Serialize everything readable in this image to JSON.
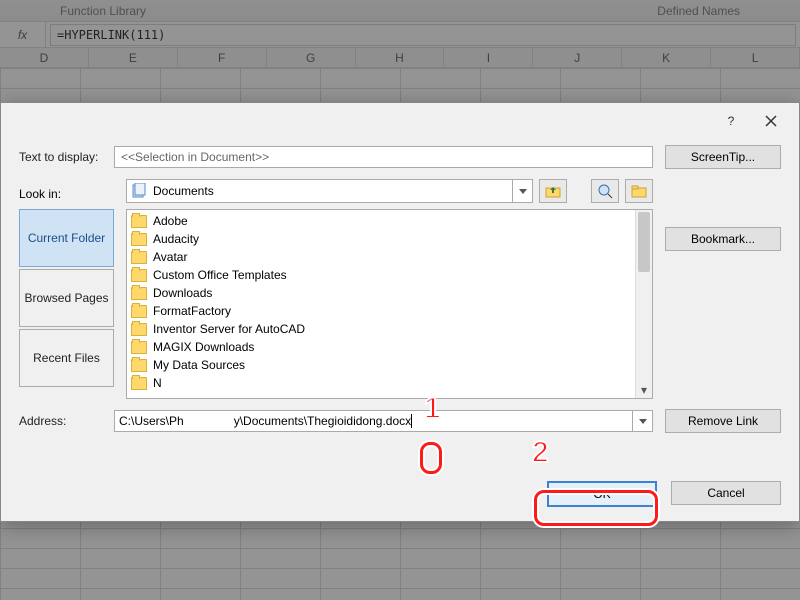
{
  "ribbon": {
    "group_left": "Function Library",
    "group_right": "Defined Names"
  },
  "formula": {
    "fx": "fx",
    "value": "=HYPERLINK(111)"
  },
  "columns": [
    "D",
    "E",
    "F",
    "G",
    "H",
    "I",
    "J",
    "K",
    "L"
  ],
  "dialog": {
    "help_tip": "?",
    "text_to_display_label": "Text to display:",
    "text_to_display_value": "<<Selection in Document>>",
    "screentip_btn": "ScreenTip...",
    "lookin_label": "Look in:",
    "lookin_value": "Documents",
    "side_tabs": {
      "current": "Current Folder",
      "browsed": "Browsed Pages",
      "recent": "Recent Files"
    },
    "folders": [
      "Adobe",
      "Audacity",
      "Avatar",
      "Custom Office Templates",
      "Downloads",
      "FormatFactory",
      "Inventor Server for AutoCAD",
      "MAGIX Downloads",
      "My Data Sources",
      "N"
    ],
    "bookmark_btn": "Bookmark...",
    "address_label": "Address:",
    "address_value_pre": "C:\\Users\\Ph",
    "address_value_post": "y\\Documents\\Thegioididong.docx",
    "remove_link_btn": "Remove Link",
    "ok_btn": "OK",
    "cancel_btn": "Cancel"
  },
  "steps": {
    "one": "1",
    "two": "2"
  }
}
